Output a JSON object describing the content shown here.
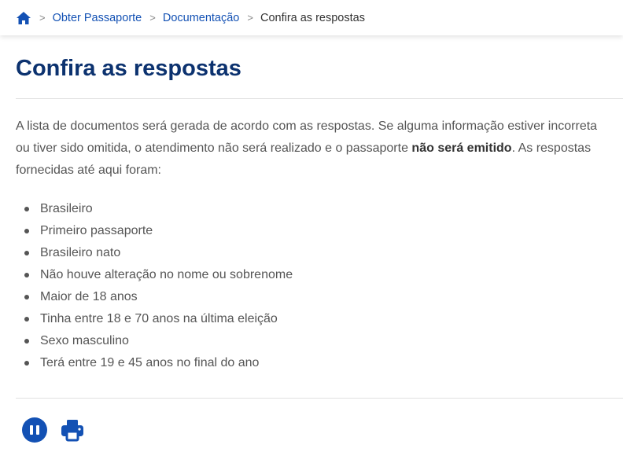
{
  "breadcrumb": {
    "home_icon": "home-icon",
    "separator": ">",
    "items": [
      {
        "label": "Obter Passaporte"
      },
      {
        "label": "Documentação"
      }
    ],
    "current": "Confira as respostas"
  },
  "page": {
    "title": "Confira as respostas",
    "intro_before": "A lista de documentos será gerada de acordo com as respostas. Se alguma informação estiver incorreta ou tiver sido omitida, o atendimento não será realizado e o passaporte ",
    "intro_bold": "não será emitido",
    "intro_after": ". As respostas fornecidas até aqui foram:",
    "answers": [
      "Brasileiro",
      "Primeiro passaporte",
      "Brasileiro nato",
      "Não houve alteração no nome ou sobrenome",
      "Maior de 18 anos",
      "Tinha entre 18 e 70 anos na última eleição",
      "Sexo masculino",
      "Terá entre 19 e 45 anos no final do ano"
    ]
  },
  "actions": {
    "pause_icon": "pause-icon",
    "print_icon": "print-icon"
  },
  "colors": {
    "primary": "#1351b4",
    "title": "#0c326f",
    "text": "#555555"
  }
}
